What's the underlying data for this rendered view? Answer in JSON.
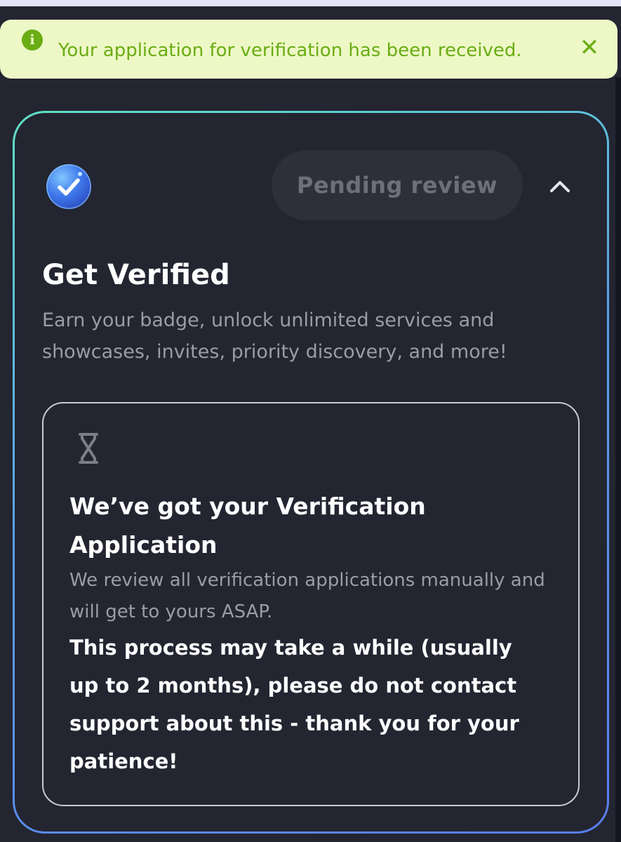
{
  "toast": {
    "message": "Your application for verification has been received.",
    "info_glyph": "i",
    "close_glyph": "✕",
    "info_icon": "info-circle-icon",
    "color": "#6aad14"
  },
  "card": {
    "badge_icon": "verified-check-icon",
    "status": "Pending review",
    "collapse_icon": "chevron-up-icon",
    "title": "Get Verified",
    "description": "Earn your badge, unlock unlimited services and showcases, invites, priority discovery, and more!",
    "border_gradient": [
      "#61e0c7",
      "#5aa1ea",
      "#5a7dee"
    ]
  },
  "notice": {
    "icon": "hourglass-icon",
    "title": "We’ve got your Verification Application",
    "subtext": "We review all verification applications manually and will get to yours ASAP.",
    "note": "This process may take a while (usually up to 2 months), please do not contact support about this - thank you for your patience!"
  },
  "colors": {
    "background": "#232531",
    "toast_background": "#eef8c6",
    "pill_background": "#2e3039",
    "muted_text": "#9a9ca6"
  }
}
